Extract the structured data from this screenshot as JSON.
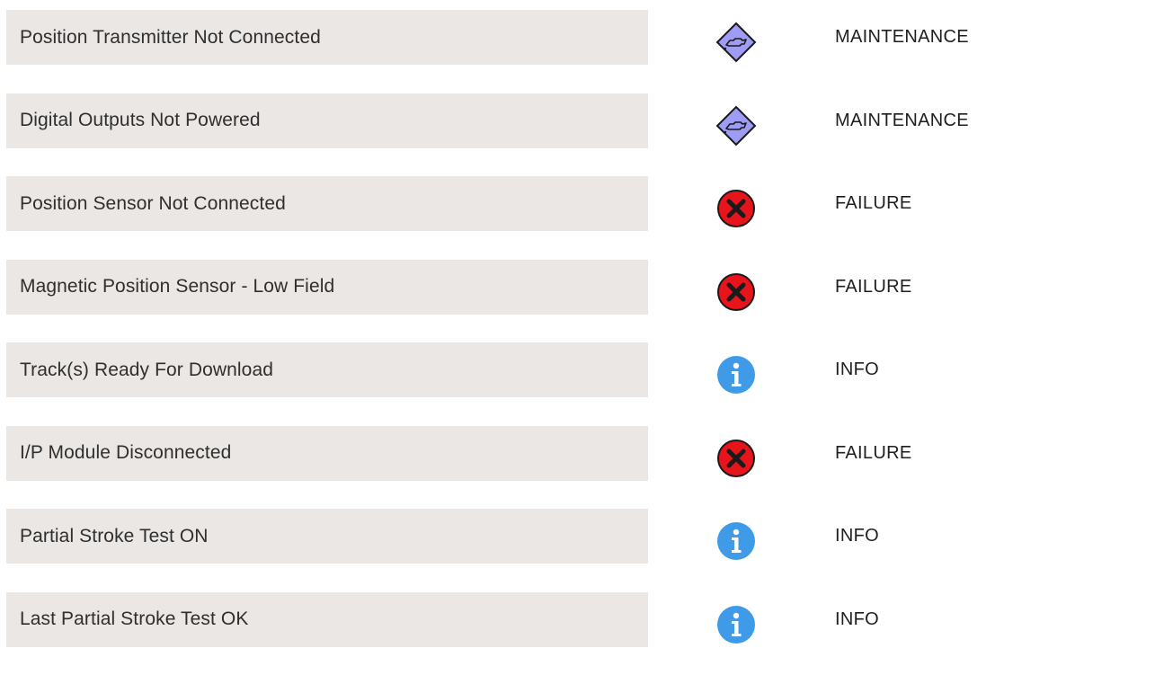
{
  "alarms": [
    {
      "label": "Position Transmitter Not Connected",
      "icon": "maintenance-icon",
      "severity": "MAINTENANCE"
    },
    {
      "label": "Digital Outputs Not Powered",
      "icon": "maintenance-icon",
      "severity": "MAINTENANCE"
    },
    {
      "label": "Position Sensor Not Connected",
      "icon": "failure-icon",
      "severity": "FAILURE"
    },
    {
      "label": "Magnetic Position Sensor - Low Field",
      "icon": "failure-icon",
      "severity": "FAILURE"
    },
    {
      "label": "Track(s) Ready For Download",
      "icon": "info-icon",
      "severity": "INFO"
    },
    {
      "label": "I/P Module Disconnected",
      "icon": "failure-icon",
      "severity": "FAILURE"
    },
    {
      "label": "Partial Stroke Test ON",
      "icon": "info-icon",
      "severity": "INFO"
    },
    {
      "label": "Last Partial Stroke Test OK",
      "icon": "info-icon",
      "severity": "INFO"
    }
  ],
  "colors": {
    "row_background": "#ebe7e4",
    "maintenance": "#9f9cf6",
    "failure": "#e8141c",
    "info": "#3f9be8"
  }
}
